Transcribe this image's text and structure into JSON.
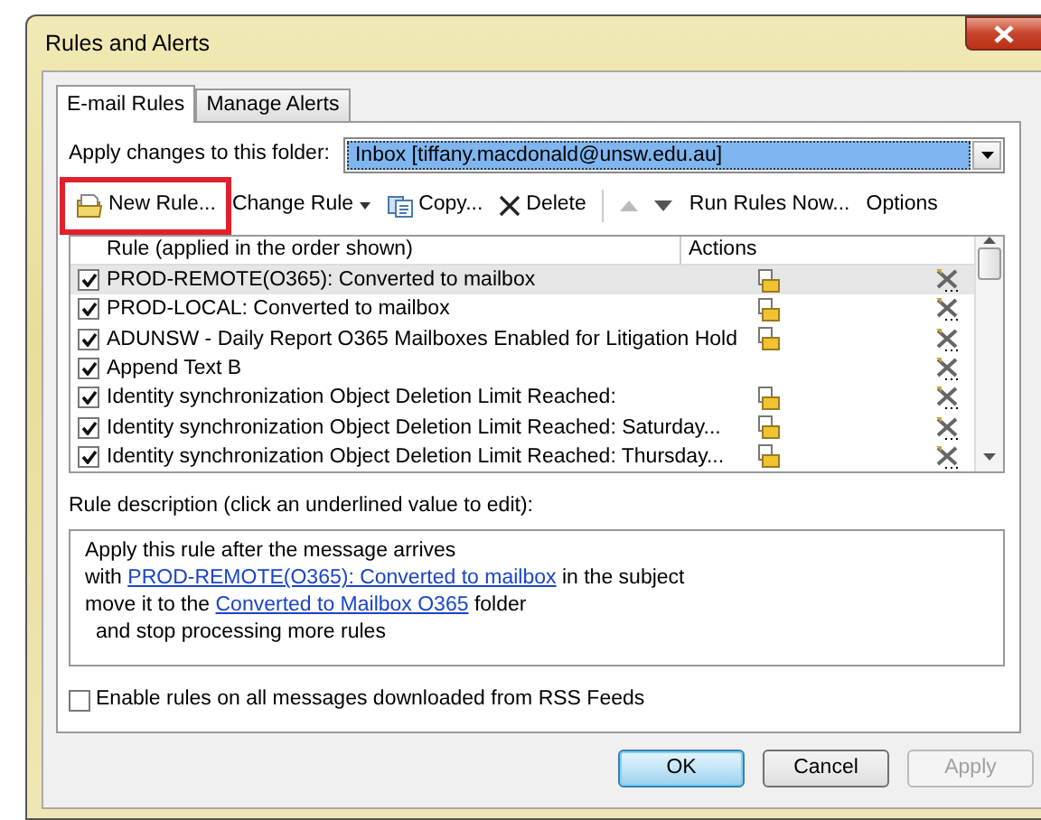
{
  "window": {
    "title": "Rules and Alerts"
  },
  "tabs": [
    {
      "label": "E-mail Rules",
      "selected": true
    },
    {
      "label": "Manage Alerts",
      "selected": false
    }
  ],
  "folder": {
    "label": "Apply changes to this folder:",
    "value": "Inbox [tiffany.macdonald@unsw.edu.au]"
  },
  "toolbar": [
    {
      "label": "New Rule...",
      "kind": "new",
      "disabled": false,
      "highlighted": true
    },
    {
      "label": "Change Rule",
      "kind": "menu",
      "disabled": false,
      "highlighted": false
    },
    {
      "label": "Copy...",
      "kind": "copy",
      "disabled": false,
      "highlighted": false
    },
    {
      "label": "Delete",
      "kind": "delete",
      "disabled": false,
      "highlighted": false
    },
    {
      "kind": "up",
      "disabled": true,
      "highlighted": false
    },
    {
      "kind": "down",
      "disabled": false,
      "highlighted": false
    },
    {
      "label": "Run Rules Now...",
      "kind": "plain",
      "disabled": false,
      "highlighted": false
    },
    {
      "label": "Options",
      "kind": "plain",
      "disabled": false,
      "highlighted": false
    }
  ],
  "table": {
    "columns": [
      "Rule (applied in the order shown)",
      "Actions"
    ],
    "rows": [
      {
        "name": "PROD-REMOTE(O365): Converted to mailbox",
        "checked": true,
        "selected": true,
        "move_action": true
      },
      {
        "name": "PROD-LOCAL: Converted to mailbox",
        "checked": true,
        "selected": false,
        "move_action": true
      },
      {
        "name": "ADUNSW - Daily Report O365 Mailboxes Enabled for Litigation Hold",
        "checked": true,
        "selected": false,
        "move_action": true
      },
      {
        "name": "Append Text B",
        "checked": true,
        "selected": false,
        "move_action": false
      },
      {
        "name": "Identity synchronization Object Deletion Limit Reached:",
        "checked": true,
        "selected": false,
        "move_action": true
      },
      {
        "name": "Identity synchronization Object Deletion Limit Reached: Saturday...",
        "checked": true,
        "selected": false,
        "move_action": true
      },
      {
        "name": "Identity synchronization Object Deletion Limit Reached: Thursday...",
        "checked": true,
        "selected": false,
        "move_action": true
      }
    ]
  },
  "description": {
    "label": "Rule description (click an underlined value to edit):",
    "lines": [
      [
        {
          "text": "Apply this rule after the message arrives",
          "link": false
        }
      ],
      [
        {
          "text": "with",
          "link": false
        },
        {
          "text": "PROD-REMOTE(O365): Converted to mailbox",
          "link": true
        },
        {
          "text": "in the subject",
          "link": false
        }
      ],
      [
        {
          "text": "move it to the",
          "link": false
        },
        {
          "text": "Converted to Mailbox O365",
          "link": true
        },
        {
          "text": "folder",
          "link": false
        }
      ],
      [
        {
          "text": "and stop processing more rules",
          "link": false,
          "indent": true
        }
      ]
    ]
  },
  "rss": {
    "label": "Enable rules on all messages downloaded from RSS Feeds",
    "checked": false
  },
  "buttons": [
    {
      "label": "OK",
      "default": true,
      "disabled": false
    },
    {
      "label": "Cancel",
      "default": false,
      "disabled": false
    },
    {
      "label": "Apply",
      "default": false,
      "disabled": true
    }
  ]
}
